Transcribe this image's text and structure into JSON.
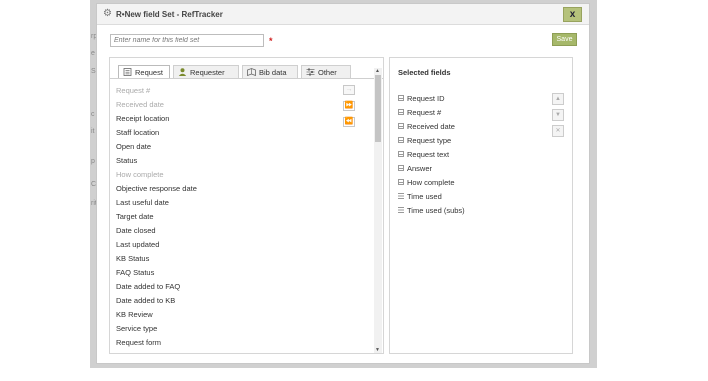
{
  "dialog": {
    "title": "R•New field Set - RefTracker",
    "close_label": "x",
    "name_placeholder": "Enter name for this field set",
    "required_marker": "*",
    "save_label": "Save"
  },
  "tabs": [
    {
      "label": "Request",
      "icon": "form-icon",
      "active": true
    },
    {
      "label": "Requester",
      "icon": "person-icon",
      "active": false
    },
    {
      "label": "Bib data",
      "icon": "book-icon",
      "active": false
    },
    {
      "label": "Other",
      "icon": "sliders-icon",
      "active": false
    }
  ],
  "available_fields": [
    {
      "label": "Request #",
      "disabled": true
    },
    {
      "label": "Received date",
      "disabled": true
    },
    {
      "label": "Receipt location",
      "disabled": false
    },
    {
      "label": "Staff location",
      "disabled": false
    },
    {
      "label": "Open date",
      "disabled": false
    },
    {
      "label": "Status",
      "disabled": false
    },
    {
      "label": "How complete",
      "disabled": true
    },
    {
      "label": "Objective response date",
      "disabled": false
    },
    {
      "label": "Last useful date",
      "disabled": false
    },
    {
      "label": "Target date",
      "disabled": false
    },
    {
      "label": "Date closed",
      "disabled": false
    },
    {
      "label": "Last updated",
      "disabled": false
    },
    {
      "label": "KB Status",
      "disabled": false
    },
    {
      "label": "FAQ Status",
      "disabled": false
    },
    {
      "label": "Date added to FAQ",
      "disabled": false
    },
    {
      "label": "Date added to KB",
      "disabled": false
    },
    {
      "label": "KB Review",
      "disabled": false
    },
    {
      "label": "Service type",
      "disabled": false
    },
    {
      "label": "Request form",
      "disabled": false
    }
  ],
  "transfer_buttons": {
    "add_one": "→",
    "add_all": "⏩",
    "remove_all": "⏪"
  },
  "selected": {
    "heading": "Selected fields",
    "items": [
      {
        "label": "Request ID",
        "icon": "grid-icon"
      },
      {
        "label": "Request #",
        "icon": "grid-icon"
      },
      {
        "label": "Received date",
        "icon": "grid-icon"
      },
      {
        "label": "Request type",
        "icon": "grid-icon"
      },
      {
        "label": "Request text",
        "icon": "grid-icon"
      },
      {
        "label": "Answer",
        "icon": "grid-icon"
      },
      {
        "label": "How complete",
        "icon": "grid-icon"
      },
      {
        "label": "Time used",
        "icon": "lines-icon"
      },
      {
        "label": "Time used (subs)",
        "icon": "lines-icon"
      }
    ]
  },
  "order_buttons": {
    "up": "▲",
    "down": "▼",
    "remove": "✕"
  },
  "background_text": [
    "rp",
    "e",
    "Si",
    "c",
    "it",
    "p",
    "C",
    "rit"
  ]
}
